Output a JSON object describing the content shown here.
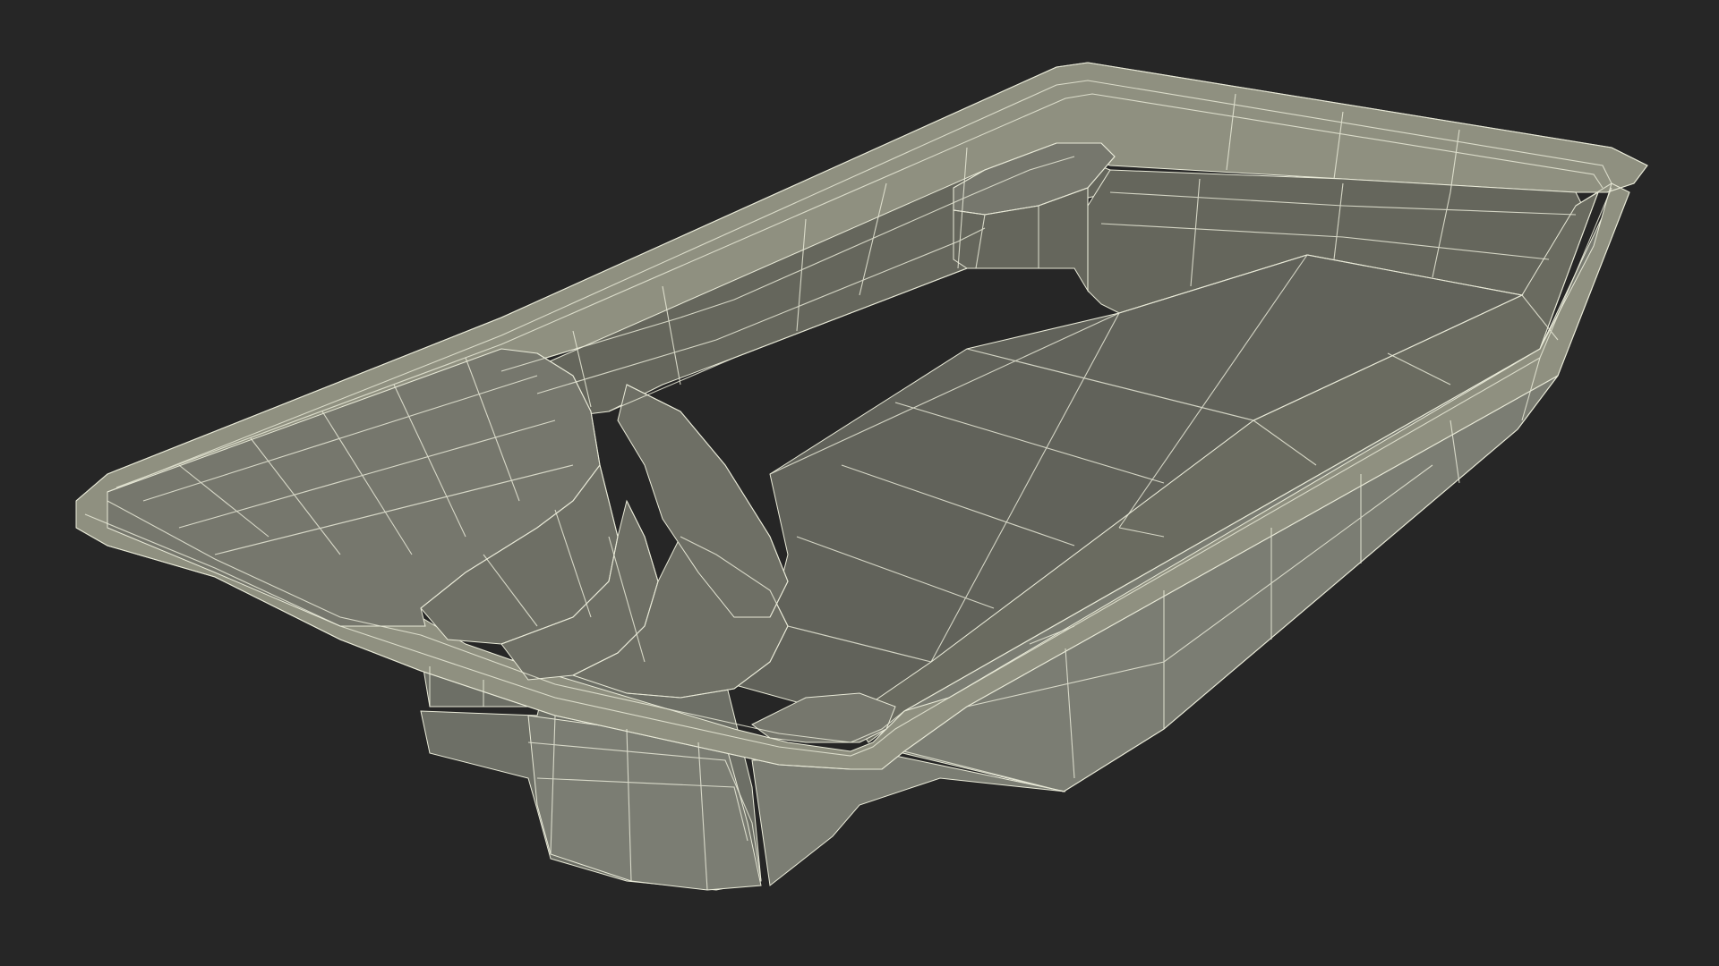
{
  "scene": {
    "subject": "pool-shell-wireframe-render",
    "colors": {
      "background": "#262626",
      "rim_top": "#8f9080",
      "rim_outer": "#80827a",
      "inner_wall_far": "#65665c",
      "inner_wall_side": "#6a6b60",
      "floor": "#61625a",
      "bench_deck": "#76776d",
      "steps": "#6e6f65",
      "outer_wall": "#7b7d73",
      "outer_wall_dark": "#6d6f66",
      "wire": "#e9ead8"
    }
  }
}
